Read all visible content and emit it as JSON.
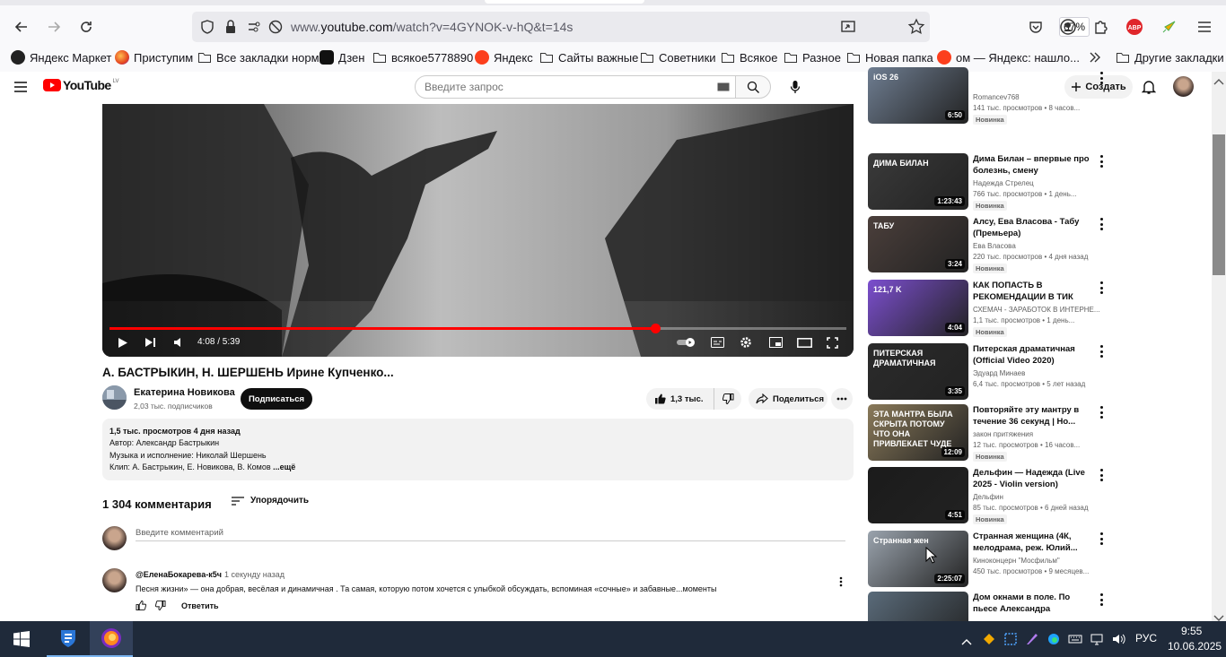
{
  "browser": {
    "url_prefix": "www.",
    "url_host": "youtube.com",
    "url_path": "/watch?v=4GYNOK-v-hQ&t=14s",
    "zoom": "67%",
    "bookmarks": [
      "Яндекс Маркет",
      "Приступим",
      "Все закладки норм",
      "Дзен",
      "всякое5778890",
      "Яндекс",
      "Сайты важные",
      "Советники",
      "Всякое",
      "Разное",
      "Новая папка",
      "ом — Яндекс: нашло..."
    ],
    "other_bookmarks": "Другие закладки"
  },
  "yt": {
    "logo": "YouTube",
    "region": "LV",
    "search_placeholder": "Введите запрос",
    "create": "Создать"
  },
  "player": {
    "time": "4:08 / 5:39",
    "progress": 0.74
  },
  "video": {
    "title": "А. БАСТРЫКИН, Н. ШЕРШЕНЬ Ирине Купченко...",
    "channel": "Екатерина Новикова",
    "subs": "2,03 тыс. подписчиков",
    "subscribe": "Подписаться",
    "likes": "1,3 тыс.",
    "share": "Поделиться",
    "description": {
      "meta": "1,5 тыс. просмотров  4 дня назад",
      "line1": "Автор: Александр Бастрыкин",
      "line2": "Музыка и исполнение: Николай Шершень",
      "line3": "Клип: А. Бастрыкин, Е. Новикова, В. Комов",
      "more": "...ещё"
    }
  },
  "comments": {
    "count": "1 304 комментария",
    "sort": "Упорядочить",
    "placeholder": "Введите комментарий",
    "first": {
      "author": "@ЕленаБокарева-к5ч",
      "time": "1 секунду назад",
      "text": "Песня жизни» — она добрая, весёлая и динамичная . Та самая, которую потом хочется с улыбкой обсуждать, вспоминая «сочные» и забавные...моменты",
      "reply": "Ответить"
    }
  },
  "recs": [
    {
      "title": "",
      "thumb_text": "iOS 26",
      "channel": "Romancev768",
      "stats": "141 тыс. просмотров • 8 часов...",
      "dur": "6:50",
      "new": "Новинка"
    },
    {
      "title": "Дима Билан – впервые про болезнь, смену продюсера,...",
      "thumb_text": "ДИМА БИЛАН",
      "channel": "Надежда Стрелец",
      "stats": "766 тыс. просмотров • 1 день...",
      "dur": "1:23:43",
      "new": "Новинка"
    },
    {
      "title": "Алсу, Ева Власова - Табу (Премьера)",
      "thumb_text": "ТАБУ",
      "channel": "Ева Власова",
      "stats": "220 тыс. просмотров • 4 дня назад",
      "dur": "3:24",
      "new": "Новинка"
    },
    {
      "title": "КАК ПОПАСТЬ В РЕКОМЕНДАЦИИ В ТИК ТОК...",
      "thumb_text": "121,7 K",
      "channel": "СХЕМАЧ - ЗАРАБОТОК В ИНТЕРНЕ...",
      "stats": "1,1 тыс. просмотров • 1 день...",
      "dur": "4:04",
      "new": "Новинка"
    },
    {
      "title": "Питерская драматичная (Official Video 2020)",
      "thumb_text": "ПИТЕРСКАЯ ДРАМАТИЧНАЯ",
      "channel": "Эдуард Минаев",
      "stats": "6,4 тыс. просмотров • 5 лет назад",
      "dur": "3:35",
      "new": ""
    },
    {
      "title": "Повторяйте эту мантру в течение 36 секунд | Но...",
      "thumb_text": "ЭТА МАНТРА БЫЛА СКРЫТА ПОТОМУ ЧТО ОНА ПРИВЛЕКАЕТ ЧУДЕ",
      "channel": "закон притяжения",
      "stats": "12 тыс. просмотров • 16 часов...",
      "dur": "12:09",
      "new": "Новинка"
    },
    {
      "title": "Дельфин — Надежда (Live 2025 - Violin version)",
      "thumb_text": "",
      "channel": "Дельфин",
      "stats": "85 тыс. просмотров • 6 дней назад",
      "dur": "4:51",
      "new": "Новинка"
    },
    {
      "title": "Странная женщина (4К, мелодрама, реж. Юлий...",
      "thumb_text": "Странная жен",
      "channel": "Киноконцерн \"Мосфильм\"",
      "stats": "450 тыс. просмотров • 9 месяцев...",
      "dur": "2:25:07",
      "new": ""
    },
    {
      "title": "Дом окнами в поле. По пьесе Александра Вампилова...",
      "thumb_text": "",
      "channel": "",
      "stats": "",
      "dur": "",
      "new": ""
    }
  ],
  "taskbar": {
    "lang": "РУС",
    "time": "9:55",
    "date": "10.06.2025"
  },
  "colors": {
    "yt_red": "#ff0000",
    "taskbar": "#1f2a3a"
  }
}
